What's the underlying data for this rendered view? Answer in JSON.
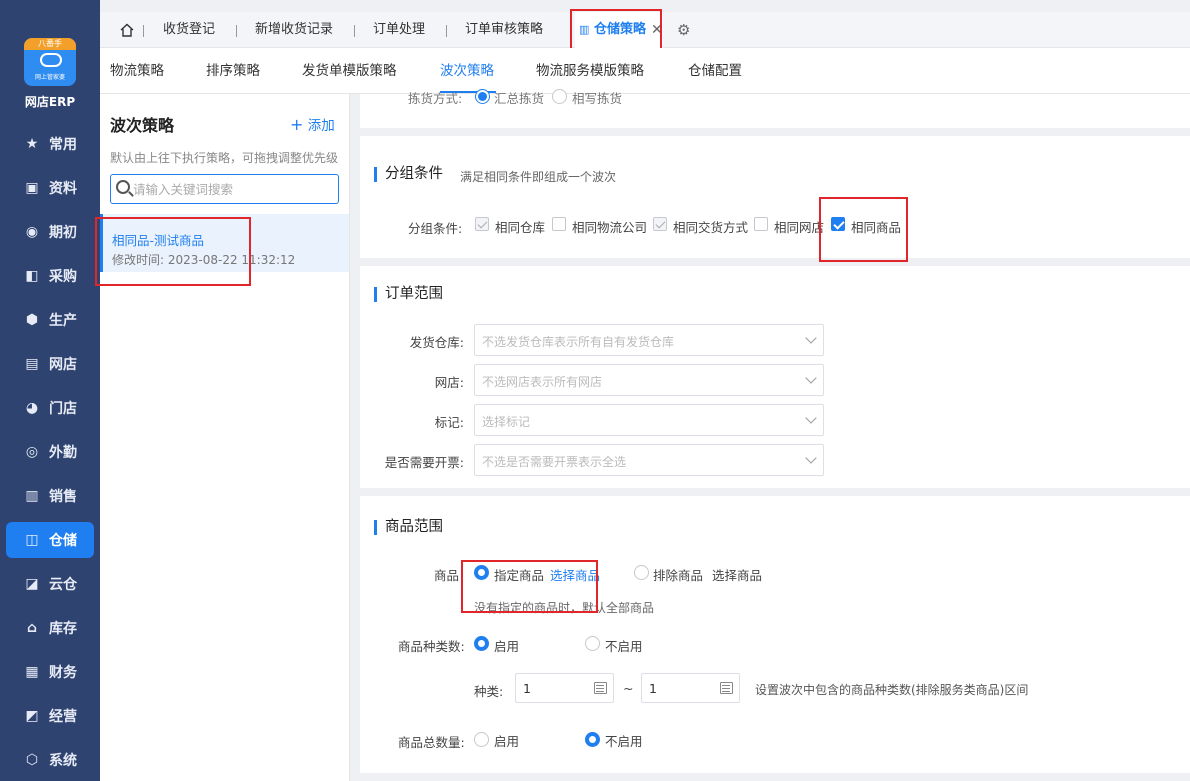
{
  "sidebar": {
    "logo_badge": "八番手",
    "logo_sub": "网上管家婆",
    "app_name": "网店ERP",
    "items": [
      {
        "label": "常用",
        "icon": "star-icon",
        "glyph": "★"
      },
      {
        "label": "资料",
        "icon": "info-icon",
        "glyph": "▣"
      },
      {
        "label": "期初",
        "icon": "target-icon",
        "glyph": "◉"
      },
      {
        "label": "采购",
        "icon": "purchase-icon",
        "glyph": "◧"
      },
      {
        "label": "生产",
        "icon": "production-icon",
        "glyph": "⬢"
      },
      {
        "label": "网店",
        "icon": "shop-icon",
        "glyph": "▤"
      },
      {
        "label": "门店",
        "icon": "store-icon",
        "glyph": "◕"
      },
      {
        "label": "外勤",
        "icon": "field-icon",
        "glyph": "◎"
      },
      {
        "label": "销售",
        "icon": "sales-icon",
        "glyph": "▥"
      },
      {
        "label": "仓储",
        "icon": "warehouse-icon",
        "glyph": "◫",
        "active": true
      },
      {
        "label": "云仓",
        "icon": "cloud-warehouse-icon",
        "glyph": "◪"
      },
      {
        "label": "库存",
        "icon": "inventory-icon",
        "glyph": "⌂"
      },
      {
        "label": "财务",
        "icon": "finance-icon",
        "glyph": "▦"
      },
      {
        "label": "经营",
        "icon": "operation-icon",
        "glyph": "◩"
      },
      {
        "label": "系统",
        "icon": "system-icon",
        "glyph": "⬡"
      }
    ]
  },
  "top_tabs": [
    "收货登记",
    "新增收货记录",
    "订单处理",
    "订单审核策略",
    "仓储策略"
  ],
  "sub_tabs": [
    "物流策略",
    "排序策略",
    "发货单模版策略",
    "波次策略",
    "物流服务模版策略",
    "仓储配置"
  ],
  "list_panel": {
    "title": "波次策略",
    "add_label": "添加",
    "hint": "默认由上往下执行策略，可拖拽调整优先级",
    "search_placeholder": "请输入关键词搜索",
    "item_name": "相同品-测试商品",
    "item_time": "修改时间:  2023-08-22 11:32:12"
  },
  "partial_row": {
    "label": "拣货方式:",
    "opt1": "汇总拣货",
    "opt2": "相写拣货"
  },
  "group": {
    "title": "分组条件",
    "desc": "满足相同条件即组成一个波次",
    "label": "分组条件:",
    "options": [
      "相同仓库",
      "相同物流公司",
      "相同交货方式",
      "相同网店",
      "相同商品"
    ]
  },
  "order_scope": {
    "title": "订单范围",
    "rows": [
      {
        "label": "发货仓库:",
        "placeholder": "不选发货仓库表示所有自有发货仓库"
      },
      {
        "label": "网店:",
        "placeholder": "不选网店表示所有网店"
      },
      {
        "label": "标记:",
        "placeholder": "选择标记"
      },
      {
        "label": "是否需要开票:",
        "placeholder": "不选是否需要开票表示全选"
      }
    ]
  },
  "goods_scope": {
    "title": "商品范围",
    "goods_label": "商品",
    "opt_specified": "指定商品",
    "select_link": "选择商品",
    "opt_exclude": "排除商品",
    "select_link2": "选择商品",
    "goods_hint": "没有指定的商品时，默认全部商品",
    "kind_label": "商品种类数:",
    "enable": "启用",
    "disable": "不启用",
    "kind_range_label": "种类:",
    "kind_min": "1",
    "kind_max": "1",
    "range_sep": "~",
    "kind_range_hint": "设置波次中包含的商品种类数(排除服务类商品)区间",
    "total_label": "商品总数量:",
    "enable2": "启用",
    "disable2": "不启用"
  },
  "colors": {
    "accent": "#1f7ff0",
    "sidebar": "#2f4370",
    "highlight": "#e0262b"
  }
}
